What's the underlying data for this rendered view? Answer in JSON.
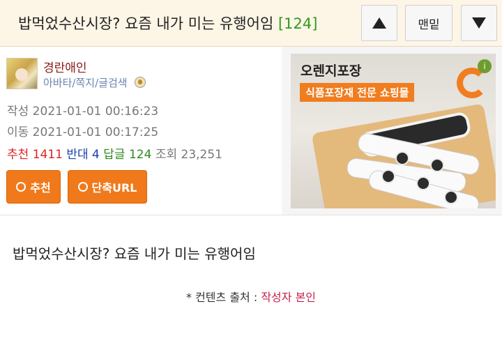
{
  "header": {
    "title": "밥먹었수산시장? 요즘 내가 미는 유행어임",
    "comment_count": "[124]",
    "up_icon": "triangle-up-icon",
    "top_label": "맨밑",
    "down_icon": "triangle-down-icon"
  },
  "author": {
    "nickname": "경란애인",
    "link_avatar": "아바타",
    "link_note": "쪽지",
    "link_search": "글검색",
    "separator": "/"
  },
  "meta": {
    "created": "작성 2021-01-01 00:16:23",
    "moved": "이동 2021-01-01 00:17:25"
  },
  "stats": {
    "recommend_label": "추천",
    "recommend": "1411",
    "oppose_label": "반대",
    "oppose": "4",
    "reply_label": "답글",
    "reply": "124",
    "view_label": "조회",
    "views": "23,251"
  },
  "buttons": {
    "recommend": "추천",
    "short_url": "단축URL"
  },
  "ad": {
    "title": "오렌지포장",
    "subtitle": "식품포장재 전문 쇼핑몰",
    "badge": "i"
  },
  "post": {
    "body": "밥먹었수산시장? 요즘 내가 미는 유행어임",
    "source_prefix": "* 컨텐츠 출처 : ",
    "source_value": "작성자 본인"
  },
  "colors": {
    "header_bg": "#fdf5e6",
    "orange": "#f07a1b",
    "comment_count": "#2e9a1e",
    "nickname": "#8b1a1a",
    "recommend": "#dd2222",
    "oppose": "#1a3fb0",
    "reply": "#2e8a1e"
  }
}
